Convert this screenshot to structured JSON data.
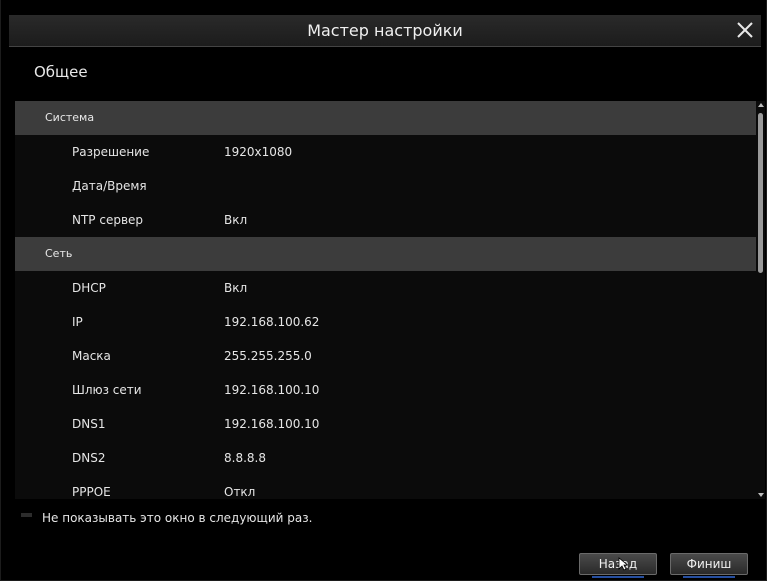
{
  "window": {
    "title": "Мастер настройки",
    "close_icon": "close-icon"
  },
  "section_title": "Общее",
  "groups": [
    {
      "header": "Система",
      "rows": [
        {
          "label": "Разрешение",
          "value": "1920x1080"
        },
        {
          "label": "Дата/Время",
          "value": ""
        },
        {
          "label": "NTP сервер",
          "value": "Вкл"
        }
      ]
    },
    {
      "header": "Сеть",
      "rows": [
        {
          "label": "DHCP",
          "value": "Вкл"
        },
        {
          "label": "IP",
          "value": "192.168.100.62"
        },
        {
          "label": "Маска",
          "value": "255.255.255.0"
        },
        {
          "label": "Шлюз сети",
          "value": "192.168.100.10"
        },
        {
          "label": "DNS1",
          "value": "192.168.100.10"
        },
        {
          "label": "DNS2",
          "value": "8.8.8.8"
        },
        {
          "label": "PPPOE",
          "value": "Откл"
        }
      ]
    }
  ],
  "footer": {
    "dont_show_label": "Не показывать это окно в следующий раз.",
    "back_label": "Назад",
    "finish_label": "Финиш"
  },
  "colors": {
    "background": "#000000",
    "group_header": "#3c3c3c",
    "accent": "#2f63c9",
    "text": "#e6e6e6"
  }
}
